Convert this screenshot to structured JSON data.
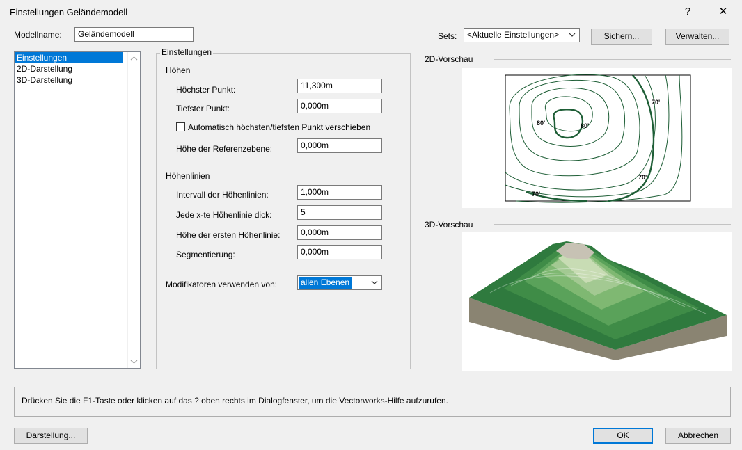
{
  "window": {
    "title": "Einstellungen Geländemodell",
    "help_glyph": "?",
    "close_glyph": "✕"
  },
  "model": {
    "label": "Modellname:",
    "value": "Geländemodell"
  },
  "sets": {
    "label": "Sets:",
    "value": "<Aktuelle Einstellungen>",
    "save_button": "Sichern...",
    "manage_button": "Verwalten..."
  },
  "nav": {
    "items": [
      {
        "label": "Einstellungen",
        "selected": true
      },
      {
        "label": "2D-Darstellung",
        "selected": false
      },
      {
        "label": "3D-Darstellung",
        "selected": false
      }
    ]
  },
  "settings": {
    "group_title": "Einstellungen",
    "heights": {
      "header": "Höhen",
      "highest_label": "Höchster Punkt:",
      "highest_value": "11,300m",
      "lowest_label": "Tiefster Punkt:",
      "lowest_value": "0,000m",
      "auto_move_label": "Automatisch höchsten/tiefsten Punkt verschieben",
      "auto_move_checked": false,
      "reference_label": "Höhe der Referenzebene:",
      "reference_value": "0,000m"
    },
    "contours": {
      "header": "Höhenlinien",
      "interval_label": "Intervall der Höhenlinien:",
      "interval_value": "1,000m",
      "every_nth_label": "Jede x-te Höhenlinie dick:",
      "every_nth_value": "5",
      "first_label": "Höhe der ersten Höhenlinie:",
      "first_value": "0,000m",
      "segment_label": "Segmentierung:",
      "segment_value": "0,000m"
    },
    "modifiers": {
      "label": "Modifikatoren verwenden von:",
      "value": "allen Ebenen"
    }
  },
  "preview": {
    "label_2d": "2D-Vorschau",
    "label_3d": "3D-Vorschau",
    "contour_labels": [
      "80'",
      "80'",
      "70'",
      "70'",
      "70'"
    ]
  },
  "status": {
    "text": "Drücken Sie die F1-Taste oder klicken auf das ? oben rechts im Dialogfenster, um die Vectorworks-Hilfe aufzurufen."
  },
  "footer": {
    "display_button": "Darstellung...",
    "ok_button": "OK",
    "cancel_button": "Abbrechen"
  },
  "colors": {
    "accent": "#0078d7",
    "contour": "#1e5e36",
    "terrain_dark": "#2f7a3e",
    "terrain_side": "#8a8472"
  }
}
